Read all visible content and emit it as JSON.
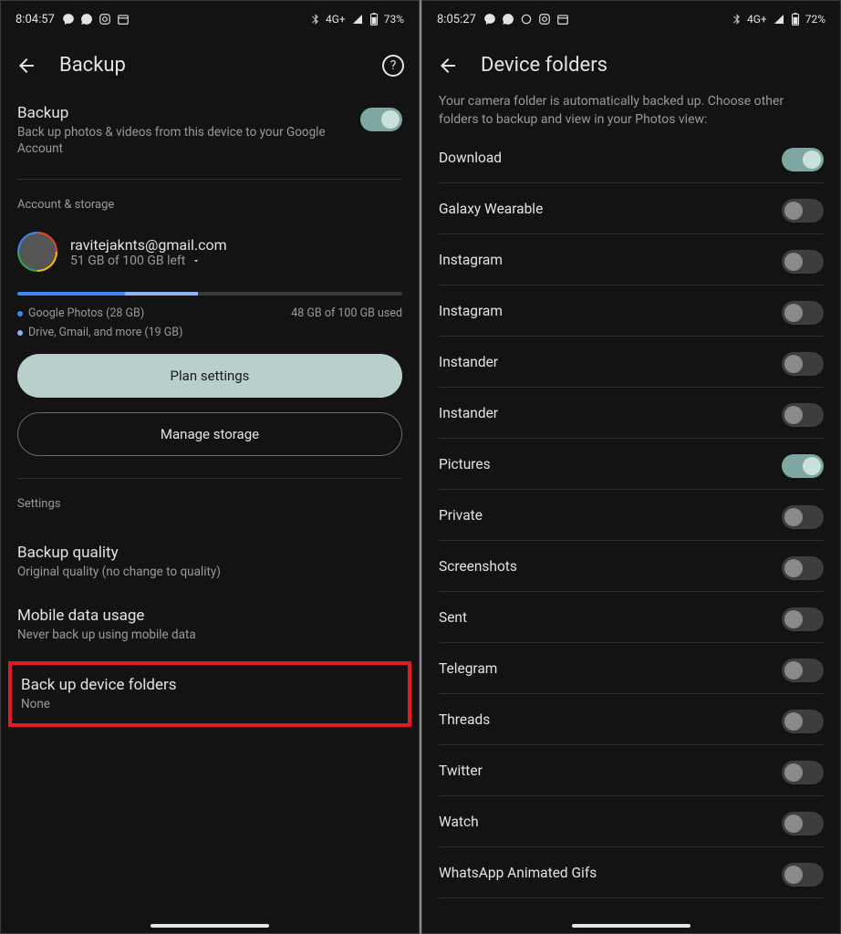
{
  "left": {
    "status": {
      "time": "8:04:57",
      "signal": "4G+",
      "battery": "73%"
    },
    "title": "Backup",
    "backup_toggle": {
      "title": "Backup",
      "sub": "Back up photos & videos from this device to your Google Account",
      "on": true
    },
    "account_section_label": "Account & storage",
    "account": {
      "email": "ravitejaknts@gmail.com",
      "storage_left": "51 GB of 100 GB left"
    },
    "storage_legend": {
      "photos": "Google Photos (28 GB)",
      "drive": "Drive, Gmail, and more (19 GB)",
      "used": "48 GB of 100 GB used"
    },
    "buttons": {
      "plan": "Plan settings",
      "manage": "Manage storage"
    },
    "settings_label": "Settings",
    "settings_items": [
      {
        "title": "Backup quality",
        "sub": "Original quality (no change to quality)"
      },
      {
        "title": "Mobile data usage",
        "sub": "Never back up using mobile data"
      },
      {
        "title": "Back up device folders",
        "sub": "None"
      }
    ]
  },
  "right": {
    "status": {
      "time": "8:05:27",
      "signal": "4G+",
      "battery": "72%"
    },
    "title": "Device folders",
    "description": "Your camera folder is automatically backed up. Choose other folders to backup and view in your Photos view:",
    "folders": [
      {
        "name": "Download",
        "on": true
      },
      {
        "name": "Galaxy Wearable",
        "on": false
      },
      {
        "name": "Instagram",
        "on": false
      },
      {
        "name": "Instagram",
        "on": false
      },
      {
        "name": "Instander",
        "on": false
      },
      {
        "name": "Instander",
        "on": false
      },
      {
        "name": "Pictures",
        "on": true
      },
      {
        "name": "Private",
        "on": false
      },
      {
        "name": "Screenshots",
        "on": false
      },
      {
        "name": "Sent",
        "on": false
      },
      {
        "name": "Telegram",
        "on": false
      },
      {
        "name": "Threads",
        "on": false
      },
      {
        "name": "Twitter",
        "on": false
      },
      {
        "name": "Watch",
        "on": false
      },
      {
        "name": "WhatsApp Animated Gifs",
        "on": false
      }
    ]
  }
}
